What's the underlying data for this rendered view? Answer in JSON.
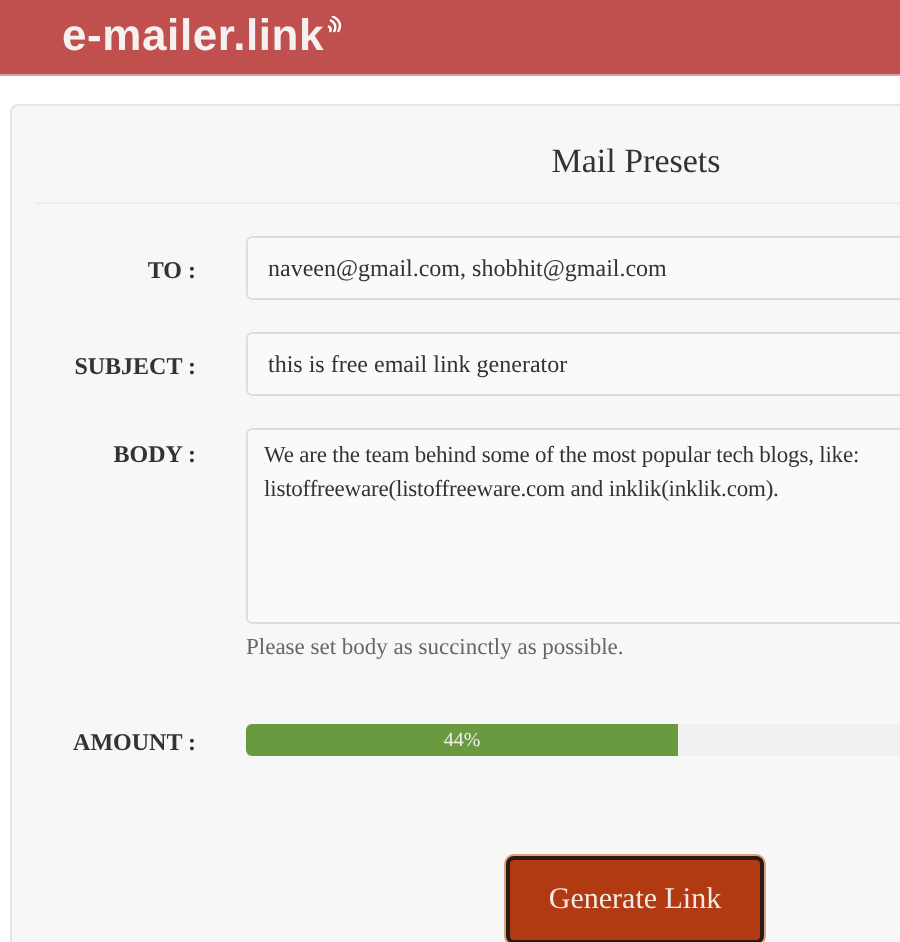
{
  "header": {
    "logo": "e-mailer.link"
  },
  "panel": {
    "title": "Mail Presets"
  },
  "fields": [
    {
      "kind": "input",
      "label": "TO :",
      "value": "naveen@gmail.com, shobhit@gmail.com"
    },
    {
      "kind": "input",
      "label": "SUBJECT :",
      "value": "this is free email link generator"
    },
    {
      "kind": "textarea",
      "label": "BODY :",
      "value": "We are the team behind some of the most popular tech blogs, like:\nlistoffreeware(listoffreeware.com and inklik(inklik.com).",
      "help": "Please set body as succinctly as possible."
    },
    {
      "kind": "progress",
      "label": "AMOUNT :",
      "level": 0.44,
      "reading": "44%"
    }
  ],
  "button": "Generate Link"
}
